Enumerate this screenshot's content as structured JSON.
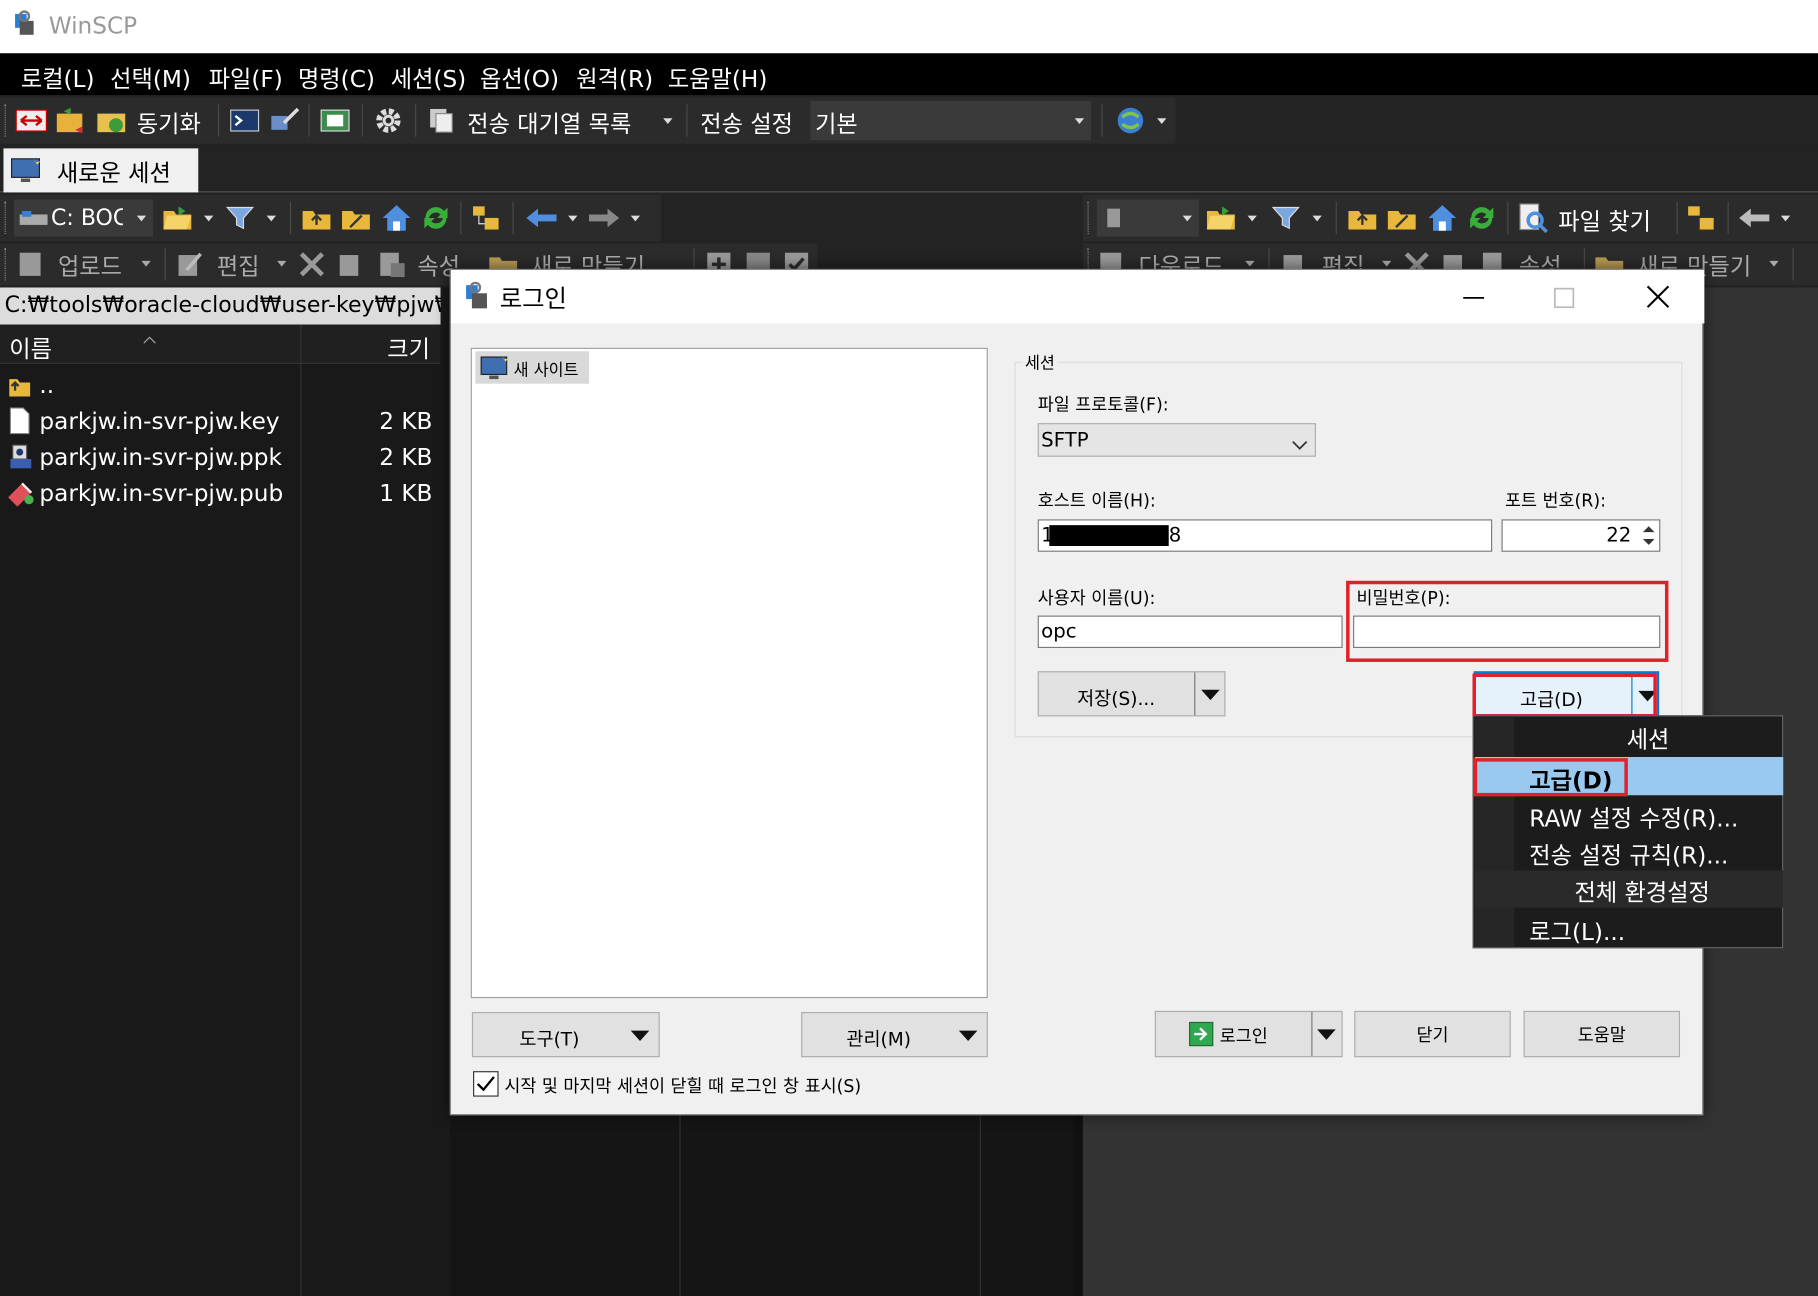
{
  "window": {
    "title": "WinSCP"
  },
  "menu": [
    "로컬(L)",
    "선택(M)",
    "파일(F)",
    "명령(C)",
    "세션(S)",
    "옵션(O)",
    "원격(R)",
    "도움말(H)"
  ],
  "toolbar": {
    "sync_label": "동기화",
    "queue_label": "전송 대기열 목록",
    "transfer_settings_label": "전송 설정",
    "transfer_preset": "기본"
  },
  "session_tab": {
    "label": "새로운 세션"
  },
  "local": {
    "drive": "C: BOC",
    "actions": {
      "upload": "업로드",
      "edit": "편집",
      "properties": "속성",
      "new": "새로 만들기"
    },
    "path": "C:₩tools₩oracle-cloud₩user-key₩pjw₩",
    "columns": {
      "name": "이름",
      "size": "크기"
    },
    "files": [
      {
        "name": "..",
        "size": "",
        "icon": "parent-folder-icon"
      },
      {
        "name": "parkjw.in-svr-pjw.key",
        "size": "2 KB",
        "icon": "file-icon"
      },
      {
        "name": "parkjw.in-svr-pjw.ppk",
        "size": "2 KB",
        "icon": "putty-key-icon"
      },
      {
        "name": "parkjw.in-svr-pjw.pub",
        "size": "1 KB",
        "icon": "public-key-icon"
      }
    ]
  },
  "remote": {
    "find_files": "파일 찾기",
    "actions": {
      "download": "다운로드",
      "edit": "편집",
      "properties": "속성",
      "new": "새로 만들기"
    }
  },
  "login": {
    "title": "로그인",
    "site_tree": {
      "new_site": "새 사이트"
    },
    "session_group": "세션",
    "protocol_label": "파일 프로토콜(F):",
    "protocol_value": "SFTP",
    "host_label": "호스트 이름(H):",
    "host_value_prefix": "1",
    "host_value_suffix": "8",
    "port_label": "포트 번호(R):",
    "port_value": "22",
    "user_label": "사용자 이름(U):",
    "user_value": "opc",
    "password_label": "비밀번호(P):",
    "password_value": "",
    "save_button": "저장(S)...",
    "advanced_button": "고급(D)",
    "tools_button": "도구(T)",
    "manage_button": "관리(M)",
    "login_button": "로그인",
    "close_button": "닫기",
    "help_button": "도움말",
    "show_login_checkbox": "시작 및 마지막 세션이 닫힐 때 로그인 창 표시(S)",
    "show_login_checked": true
  },
  "advanced_menu": {
    "items": [
      "세션",
      "고급(D)",
      "RAW 설정 수정(R)...",
      "전송 설정 규칙(R)...",
      "전체 환경설정",
      "로그(L)..."
    ],
    "highlighted": "고급(D)"
  },
  "colors": {
    "highlight_red": "#e0202a",
    "selection_blue": "#99c9ef",
    "menu_bg": "#1c1c1c",
    "dialog_bg": "#f0f0f0"
  }
}
